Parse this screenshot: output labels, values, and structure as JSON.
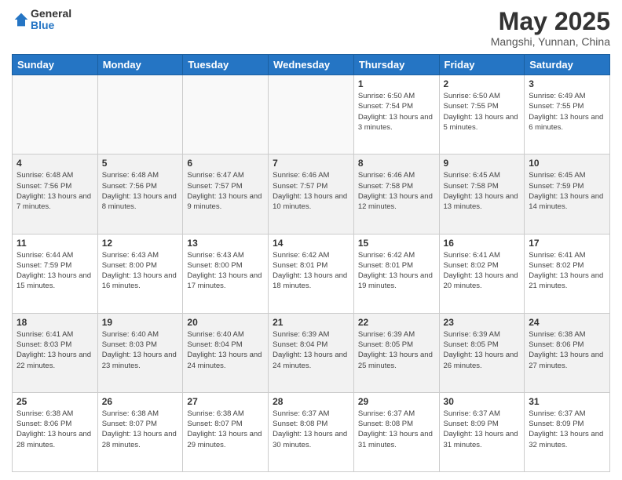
{
  "logo": {
    "general": "General",
    "blue": "Blue"
  },
  "title": "May 2025",
  "subtitle": "Mangshi, Yunnan, China",
  "weekdays": [
    "Sunday",
    "Monday",
    "Tuesday",
    "Wednesday",
    "Thursday",
    "Friday",
    "Saturday"
  ],
  "weeks": [
    [
      {
        "day": "",
        "info": ""
      },
      {
        "day": "",
        "info": ""
      },
      {
        "day": "",
        "info": ""
      },
      {
        "day": "",
        "info": ""
      },
      {
        "day": "1",
        "info": "Sunrise: 6:50 AM\nSunset: 7:54 PM\nDaylight: 13 hours and 3 minutes."
      },
      {
        "day": "2",
        "info": "Sunrise: 6:50 AM\nSunset: 7:55 PM\nDaylight: 13 hours and 5 minutes."
      },
      {
        "day": "3",
        "info": "Sunrise: 6:49 AM\nSunset: 7:55 PM\nDaylight: 13 hours and 6 minutes."
      }
    ],
    [
      {
        "day": "4",
        "info": "Sunrise: 6:48 AM\nSunset: 7:56 PM\nDaylight: 13 hours and 7 minutes."
      },
      {
        "day": "5",
        "info": "Sunrise: 6:48 AM\nSunset: 7:56 PM\nDaylight: 13 hours and 8 minutes."
      },
      {
        "day": "6",
        "info": "Sunrise: 6:47 AM\nSunset: 7:57 PM\nDaylight: 13 hours and 9 minutes."
      },
      {
        "day": "7",
        "info": "Sunrise: 6:46 AM\nSunset: 7:57 PM\nDaylight: 13 hours and 10 minutes."
      },
      {
        "day": "8",
        "info": "Sunrise: 6:46 AM\nSunset: 7:58 PM\nDaylight: 13 hours and 12 minutes."
      },
      {
        "day": "9",
        "info": "Sunrise: 6:45 AM\nSunset: 7:58 PM\nDaylight: 13 hours and 13 minutes."
      },
      {
        "day": "10",
        "info": "Sunrise: 6:45 AM\nSunset: 7:59 PM\nDaylight: 13 hours and 14 minutes."
      }
    ],
    [
      {
        "day": "11",
        "info": "Sunrise: 6:44 AM\nSunset: 7:59 PM\nDaylight: 13 hours and 15 minutes."
      },
      {
        "day": "12",
        "info": "Sunrise: 6:43 AM\nSunset: 8:00 PM\nDaylight: 13 hours and 16 minutes."
      },
      {
        "day": "13",
        "info": "Sunrise: 6:43 AM\nSunset: 8:00 PM\nDaylight: 13 hours and 17 minutes."
      },
      {
        "day": "14",
        "info": "Sunrise: 6:42 AM\nSunset: 8:01 PM\nDaylight: 13 hours and 18 minutes."
      },
      {
        "day": "15",
        "info": "Sunrise: 6:42 AM\nSunset: 8:01 PM\nDaylight: 13 hours and 19 minutes."
      },
      {
        "day": "16",
        "info": "Sunrise: 6:41 AM\nSunset: 8:02 PM\nDaylight: 13 hours and 20 minutes."
      },
      {
        "day": "17",
        "info": "Sunrise: 6:41 AM\nSunset: 8:02 PM\nDaylight: 13 hours and 21 minutes."
      }
    ],
    [
      {
        "day": "18",
        "info": "Sunrise: 6:41 AM\nSunset: 8:03 PM\nDaylight: 13 hours and 22 minutes."
      },
      {
        "day": "19",
        "info": "Sunrise: 6:40 AM\nSunset: 8:03 PM\nDaylight: 13 hours and 23 minutes."
      },
      {
        "day": "20",
        "info": "Sunrise: 6:40 AM\nSunset: 8:04 PM\nDaylight: 13 hours and 24 minutes."
      },
      {
        "day": "21",
        "info": "Sunrise: 6:39 AM\nSunset: 8:04 PM\nDaylight: 13 hours and 24 minutes."
      },
      {
        "day": "22",
        "info": "Sunrise: 6:39 AM\nSunset: 8:05 PM\nDaylight: 13 hours and 25 minutes."
      },
      {
        "day": "23",
        "info": "Sunrise: 6:39 AM\nSunset: 8:05 PM\nDaylight: 13 hours and 26 minutes."
      },
      {
        "day": "24",
        "info": "Sunrise: 6:38 AM\nSunset: 8:06 PM\nDaylight: 13 hours and 27 minutes."
      }
    ],
    [
      {
        "day": "25",
        "info": "Sunrise: 6:38 AM\nSunset: 8:06 PM\nDaylight: 13 hours and 28 minutes."
      },
      {
        "day": "26",
        "info": "Sunrise: 6:38 AM\nSunset: 8:07 PM\nDaylight: 13 hours and 28 minutes."
      },
      {
        "day": "27",
        "info": "Sunrise: 6:38 AM\nSunset: 8:07 PM\nDaylight: 13 hours and 29 minutes."
      },
      {
        "day": "28",
        "info": "Sunrise: 6:37 AM\nSunset: 8:08 PM\nDaylight: 13 hours and 30 minutes."
      },
      {
        "day": "29",
        "info": "Sunrise: 6:37 AM\nSunset: 8:08 PM\nDaylight: 13 hours and 31 minutes."
      },
      {
        "day": "30",
        "info": "Sunrise: 6:37 AM\nSunset: 8:09 PM\nDaylight: 13 hours and 31 minutes."
      },
      {
        "day": "31",
        "info": "Sunrise: 6:37 AM\nSunset: 8:09 PM\nDaylight: 13 hours and 32 minutes."
      }
    ]
  ]
}
